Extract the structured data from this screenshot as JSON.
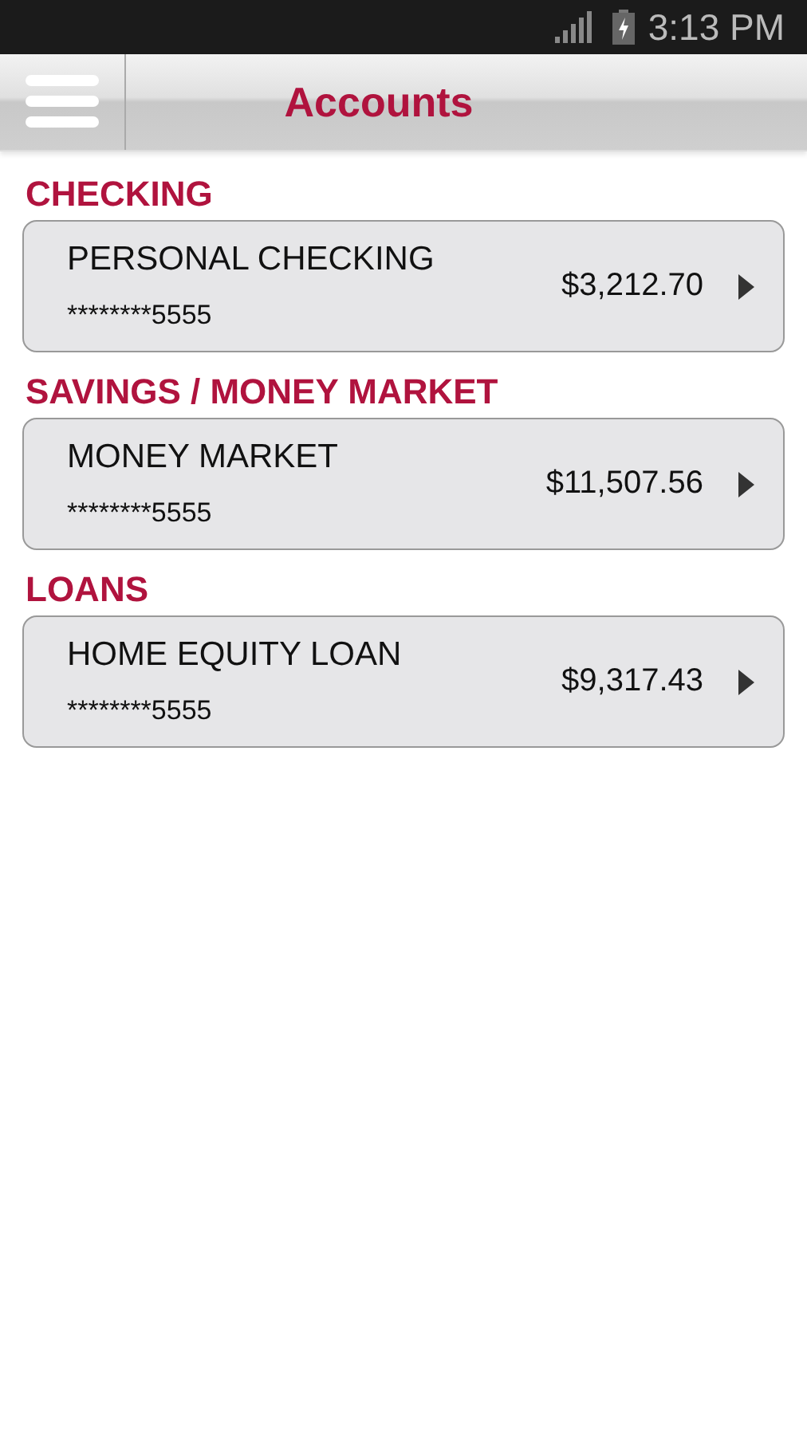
{
  "status_bar": {
    "time": "3:13 PM"
  },
  "header": {
    "title": "Accounts"
  },
  "sections": [
    {
      "title": "CHECKING",
      "accounts": [
        {
          "name": "PERSONAL CHECKING",
          "number": "********5555",
          "balance": "$3,212.70"
        }
      ]
    },
    {
      "title": "SAVINGS / MONEY MARKET",
      "accounts": [
        {
          "name": "MONEY MARKET",
          "number": "********5555",
          "balance": "$11,507.56"
        }
      ]
    },
    {
      "title": "LOANS",
      "accounts": [
        {
          "name": "HOME EQUITY LOAN",
          "number": "********5555",
          "balance": "$9,317.43"
        }
      ]
    }
  ]
}
